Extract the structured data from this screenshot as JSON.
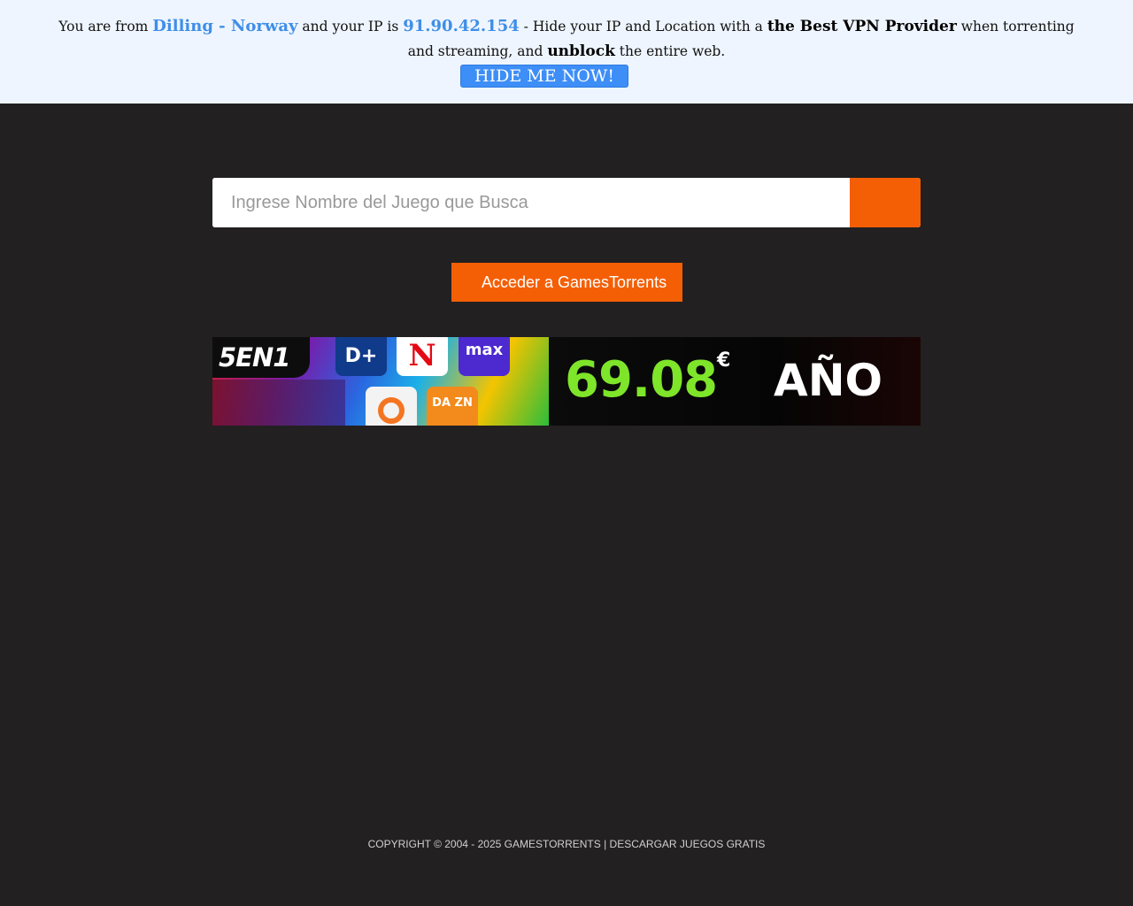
{
  "vpn_banner": {
    "text_1": "You are from ",
    "location": "Dilling - Norway",
    "text_2": " and your IP is ",
    "ip": "91.90.42.154",
    "text_3": " - Hide your IP and Location with a ",
    "provider_text": "the Best VPN Provider",
    "text_4": " when torrenting and streaming, and ",
    "unblock_text": "unblock",
    "text_5": " the entire web.",
    "button_label": "HIDE ME NOW!"
  },
  "search": {
    "placeholder": "Ingrese Nombre del Juego que Busca",
    "value": ""
  },
  "access_button_label": "Acceder a GamesTorrents",
  "ad": {
    "logo_text": "5EN1",
    "tiles": {
      "disney": "D+",
      "netflix": "N",
      "max": "max",
      "dazn": "DA ZN"
    },
    "price": "69.08",
    "currency": "€",
    "period": "AÑO",
    "colors": {
      "price": "#7ee52a"
    }
  },
  "footer": {
    "text": "COPYRIGHT © 2004 - 2025 GAMESTORRENTS | DESCARGAR JUEGOS GRATIS"
  },
  "colors": {
    "accent": "#f45f06",
    "vpn_button": "#3e8ef7",
    "vpn_highlight": "#3f8ee9",
    "background": "#222021",
    "banner_background": "#eef5fe"
  }
}
